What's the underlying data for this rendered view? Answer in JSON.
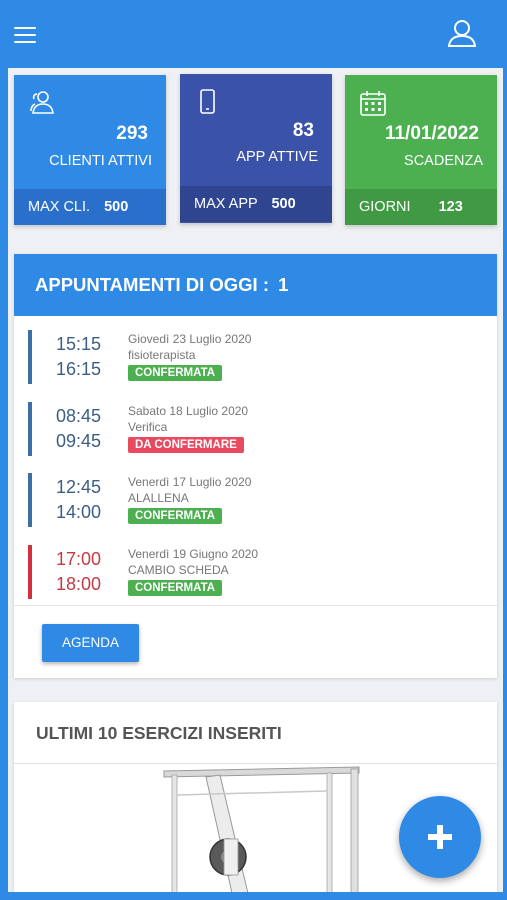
{
  "topbar": {
    "menu_icon": "hamburger-menu-icon",
    "user_icon": "user-icon"
  },
  "stats": [
    {
      "icon": "users-icon",
      "value": "293",
      "label": "CLIENTI ATTIVI",
      "foot_label": "MAX CLI.",
      "foot_value": "500",
      "color": "#2f8ae6"
    },
    {
      "icon": "smartphone-icon",
      "value": "83",
      "label": "APP ATTIVE",
      "foot_label": "MAX APP",
      "foot_value": "500",
      "color": "#3a52a8"
    },
    {
      "icon": "calendar-icon",
      "value": "11/01/2022",
      "label": "SCADENZA",
      "foot_label": "GIORNI",
      "foot_value": "123",
      "color": "#4caf50"
    }
  ],
  "appointments": {
    "title": "APPUNTAMENTI DI OGGI :",
    "count": "1",
    "items": [
      {
        "start": "15:15",
        "end": "16:15",
        "date": "Giovedì 23 Luglio 2020",
        "desc": "fisioterapista",
        "status": "CONFERMATA",
        "status_type": "ok"
      },
      {
        "start": "08:45",
        "end": "09:45",
        "date": "Sabato 18 Luglio 2020",
        "desc": "Verifica",
        "status": "DA CONFERMARE",
        "status_type": "no"
      },
      {
        "start": "12:45",
        "end": "14:00",
        "date": "Venerdì 17 Luglio 2020",
        "desc": "ALALLENA",
        "status": "CONFERMATA",
        "status_type": "ok"
      },
      {
        "start": "17:00",
        "end": "18:00",
        "date": "Venerdì 19 Giugno 2020",
        "desc": "CAMBIO SCHEDA",
        "status": "CONFERMATA",
        "status_type": "ok"
      }
    ],
    "agenda_button": "AGENDA"
  },
  "exercises": {
    "title": "ULTIMI 10 ESERCIZI INSERITI"
  },
  "fab": {
    "icon": "plus-icon"
  },
  "colors": {
    "primary": "#2f8ae6",
    "indigo": "#3a52a8",
    "green": "#4caf50",
    "danger": "#e84a5f"
  }
}
